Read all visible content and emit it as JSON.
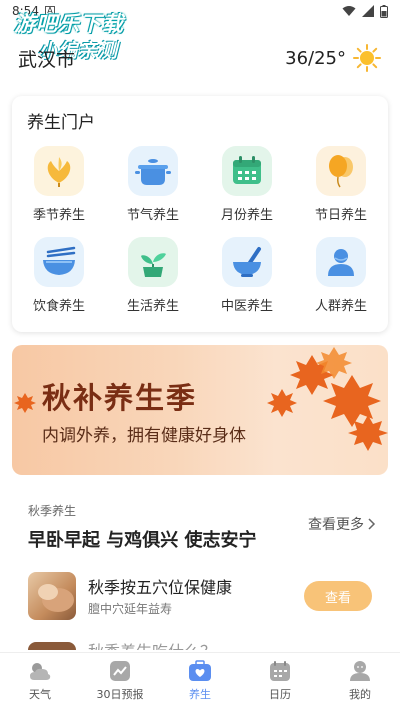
{
  "status_bar": {
    "time": "8:54",
    "badge": "A"
  },
  "watermark": {
    "line1": "游吧乐下载",
    "line2": "小编亲测"
  },
  "header": {
    "city": "武汉市",
    "temperature": "36/25°",
    "weather_icon": "sun-icon"
  },
  "portal": {
    "title": "养生门户",
    "items": [
      {
        "label": "季节养生",
        "icon": "ginkgo-leaf-icon",
        "bg": "#fdf3dd"
      },
      {
        "label": "节气养生",
        "icon": "pot-icon",
        "bg": "#e6f2fc"
      },
      {
        "label": "月份养生",
        "icon": "calendar-icon",
        "bg": "#e3f5ea"
      },
      {
        "label": "节日养生",
        "icon": "balloon-icon",
        "bg": "#fdf1dd"
      },
      {
        "label": "饮食养生",
        "icon": "bowl-chopsticks-icon",
        "bg": "#e6f2fc"
      },
      {
        "label": "生活养生",
        "icon": "sprout-pot-icon",
        "bg": "#e3f5ea"
      },
      {
        "label": "中医养生",
        "icon": "mortar-icon",
        "bg": "#e6f2fc"
      },
      {
        "label": "人群养生",
        "icon": "people-icon",
        "bg": "#e6f2fc"
      }
    ]
  },
  "banner": {
    "title": "秋补养生季",
    "subtitle": "内调外养，拥有健康好身体"
  },
  "article_section": {
    "category": "秋季养生",
    "headline": "早卧早起 与鸡俱兴 使志安宁",
    "more_label": "查看更多"
  },
  "article": {
    "title": "秋季按五穴位保健康",
    "subtitle": "膻中穴延年益寿",
    "button": "查看"
  },
  "next_article_peek": "秋季养生吃什么？",
  "tabs": [
    {
      "label": "天气",
      "icon": "cloud-sun-icon",
      "active": false
    },
    {
      "label": "30日预报",
      "icon": "trend-chart-icon",
      "active": false
    },
    {
      "label": "养生",
      "icon": "health-kit-icon",
      "active": true
    },
    {
      "label": "日历",
      "icon": "calendar-tab-icon",
      "active": false
    },
    {
      "label": "我的",
      "icon": "user-icon",
      "active": false
    }
  ],
  "colors": {
    "accent": "#5b8ef0",
    "button": "#f8c378",
    "banner_text": "#7a2e14"
  }
}
